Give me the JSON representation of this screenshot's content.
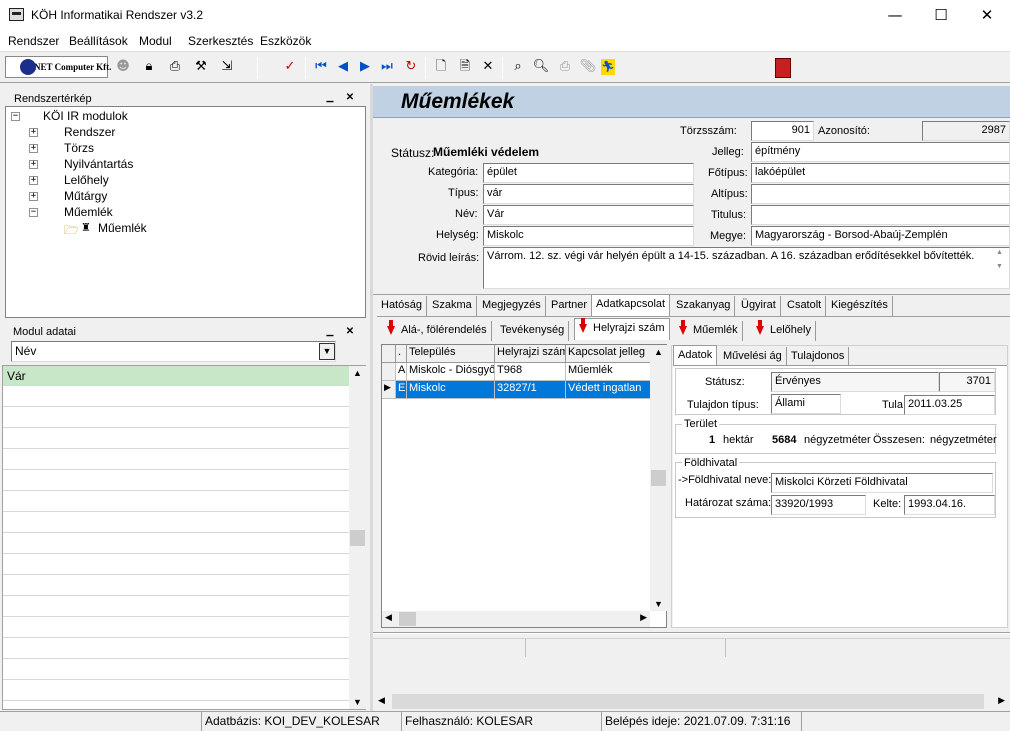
{
  "window": {
    "title": "KÖH Informatikai Rendszer v3.2",
    "minimize": "—",
    "maximize": "☐",
    "close": "✕"
  },
  "menu": [
    "Rendszer",
    "Beállítások",
    "Modul",
    "Szerkesztés",
    "Eszközök"
  ],
  "toolbar": {
    "logo_text": "NET Computer Kft."
  },
  "left": {
    "map_title": "Rendszertérkép",
    "tree": {
      "root": "KÖI IR modulok",
      "nodes": [
        "Rendszer",
        "Törzs",
        "Nyilvántartás",
        "Lelőhely",
        "Műtárgy",
        "Műemlék"
      ],
      "child": "Műemlék"
    },
    "modul_title": "Modul adatai",
    "modul_select": "Név",
    "modul_rows": [
      "Vár"
    ]
  },
  "record": {
    "header": "Műemlékek",
    "torzsszam_label": "Törzsszám:",
    "torzsszam": "901",
    "azonosito_label": "Azonosító:",
    "azonosito": "2987",
    "statusz_label": "Státusz:",
    "statusz": "Műemléki védelem",
    "jelleg_label": "Jelleg:",
    "jelleg": "építmény",
    "kategoria_label": "Kategória:",
    "kategoria": "épület",
    "fotipus_label": "Főtípus:",
    "fotipus": "lakóépület",
    "tipus_label": "Típus:",
    "tipus": "vár",
    "altipus_label": "Altípus:",
    "altipus": "",
    "nev_label": "Név:",
    "nev": "Vár",
    "titulus_label": "Titulus:",
    "titulus": "",
    "helyseg_label": "Helység:",
    "helyseg": "Miskolc",
    "megye_label": "Megye:",
    "megye": "Magyarország - Borsod-Abaúj-Zemplén",
    "rovid_label": "Rövid leírás:",
    "rovid": "Várrom. 12. sz. végi vár helyén épült a 14-15. században. A 16. században erődítésekkel bővítették."
  },
  "tabs": [
    "Hatóság",
    "Szakma",
    "Megjegyzés",
    "Partner",
    "Adatkapcsolat",
    "Szakanyag",
    "Ügyirat",
    "Csatolt",
    "Kiegészítés"
  ],
  "subtabs": [
    "Alá-, fölérendelés",
    "Tevékenység",
    "Helyrajzi szám",
    "Műemlék",
    "Lelőhely"
  ],
  "grid": {
    "columns": [
      ".",
      "Település",
      "Helyrajzi szám",
      "Kapcsolat jelleg"
    ],
    "rows": [
      {
        "marker": "",
        "c0": "A",
        "c1": "Miskolc - Diósgyőr",
        "c2": "T968",
        "c3": "Műemlék"
      },
      {
        "marker": "▶",
        "c0": "E",
        "c1": "Miskolc",
        "c2": "32827/1",
        "c3": "Védett ingatlan"
      }
    ]
  },
  "detail": {
    "tabs": [
      "Adatok",
      "Művelési ág",
      "Tulajdonos"
    ],
    "statusz_label": "Státusz:",
    "statusz": "Érvényes",
    "statusz_num": "3701",
    "tulajdon_label": "Tulajdon típus:",
    "tulajdon": "Állami",
    "tula_label": "Tula",
    "tula_date": "2011.03.25",
    "terulet_title": "Terület",
    "hektar_val": "1",
    "hektar_unit": "hektár",
    "nm_val": "5684",
    "nm_unit": "négyzetméter",
    "osszesen_label": "Összesen:",
    "osszesen_unit": "négyzetméter",
    "fh_title": "Földhivatal",
    "fh_nev_label": "->Földhivatal neve:",
    "fh_nev": "Miskolci Körzeti Földhivatal",
    "hatarozat_label": "Határozat száma:",
    "hatarozat": "33920/1993",
    "kelte_label": "Kelte:",
    "kelte": "1993.04.16."
  },
  "statusbar": {
    "db": "Adatbázis: KOI_DEV_KOLESAR",
    "user": "Felhasználó: KOLESAR",
    "login": "Belépés ideje: 2021.07.09. 7:31:16"
  }
}
